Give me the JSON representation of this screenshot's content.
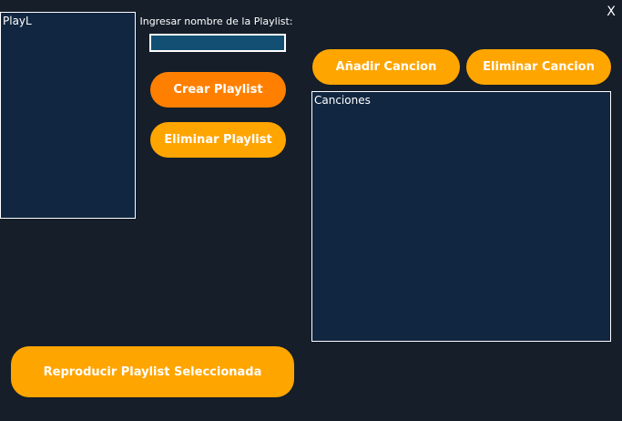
{
  "window": {
    "close_label": "X"
  },
  "playlists": {
    "header": "PlayL"
  },
  "songs": {
    "header": "Canciones"
  },
  "form": {
    "name_label": "Ingresar nombre de la Playlist:",
    "name_value": ""
  },
  "buttons": {
    "create_playlist": "Crear Playlist",
    "delete_playlist": "Eliminar Playlist",
    "add_song": "Añadir Cancion",
    "delete_song": "Eliminar Cancion",
    "play_selected": "Reproducir Playlist Seleccionada"
  },
  "colors": {
    "background": "#151e29",
    "listbox": "#112640",
    "input": "#124f73",
    "accent_primary": "#ffa500",
    "accent_active": "#ff8000"
  }
}
